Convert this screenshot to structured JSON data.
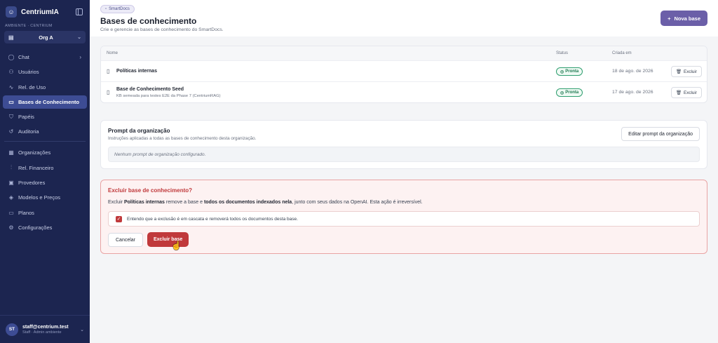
{
  "sidebar": {
    "brand": "CentriumIA",
    "env_label": "AMBIENTE · CENTRIUM",
    "org": "Org A",
    "nav_group1": [
      {
        "label": "Chat",
        "icon": "chat-icon",
        "glyph": "◯",
        "arrow": "›"
      },
      {
        "label": "Usuários",
        "icon": "users-icon",
        "glyph": "⚇"
      },
      {
        "label": "Rel. de Uso",
        "icon": "activity-icon",
        "glyph": "∿"
      },
      {
        "label": "Bases de Conhecimento",
        "icon": "book-icon",
        "glyph": "▭",
        "active": true
      },
      {
        "label": "Papéis",
        "icon": "shield-icon",
        "glyph": "⛉"
      },
      {
        "label": "Auditoria",
        "icon": "history-icon",
        "glyph": "↺"
      }
    ],
    "nav_group2": [
      {
        "label": "Organizações",
        "icon": "building-icon",
        "glyph": "▦"
      },
      {
        "label": "Rel. Financeiro",
        "icon": "bar-chart-icon",
        "glyph": "⫶"
      },
      {
        "label": "Provedores",
        "icon": "cpu-icon",
        "glyph": "▣"
      },
      {
        "label": "Modelos e Preços",
        "icon": "layers-icon",
        "glyph": "◈"
      },
      {
        "label": "Planos",
        "icon": "card-icon",
        "glyph": "▭"
      },
      {
        "label": "Configurações",
        "icon": "settings-icon",
        "glyph": "⚙"
      }
    ],
    "user": {
      "initials": "ST",
      "email": "staff@centrium.test",
      "role": "Staff · Admin ambiente"
    }
  },
  "header": {
    "tag": "SmartDocs",
    "title": "Bases de conhecimento",
    "subtitle": "Crie e gerencie as bases de conhecimento do SmartDocs.",
    "new_button": "Nova base"
  },
  "kb_table": {
    "columns": {
      "name": "Nome",
      "status": "Status",
      "created": "Criada em"
    },
    "rows": [
      {
        "name": "Políticas internas",
        "description": "",
        "status": "Pronta",
        "created": "18 de ago. de 2026",
        "action": "Excluir"
      },
      {
        "name": "Base de Conhecimento Seed",
        "description": "KB semeada para testes E2E da Phase 7 (CentriumRAG)",
        "status": "Pronta",
        "created": "17 de ago. de 2026",
        "action": "Excluir"
      }
    ]
  },
  "org_prompt": {
    "title": "Prompt da organização",
    "subtitle": "Instruções aplicadas a todas as bases de conhecimento desta organização.",
    "edit_button": "Editar prompt da organização",
    "empty_text": "Nenhum prompt de organização configurado."
  },
  "delete_confirm": {
    "title": "Excluir base de conhecimento?",
    "text_prefix": "Excluir ",
    "kb_name": "Políticas internas",
    "text_middle": " remove a base e ",
    "text_bold": "todos os documentos indexados nela",
    "text_suffix": ", junto com seus dados na OpenAI. Esta ação é irreversível.",
    "checkbox_label": "Entendo que a exclusão é em cascata e removerá todos os documentos desta base.",
    "cancel_button": "Cancelar",
    "confirm_button": "Excluir base"
  },
  "colors": {
    "sidebar": "#1c2550",
    "accent": "#6b5fa8",
    "danger": "#c0393b",
    "success": "#2f9e6f"
  }
}
